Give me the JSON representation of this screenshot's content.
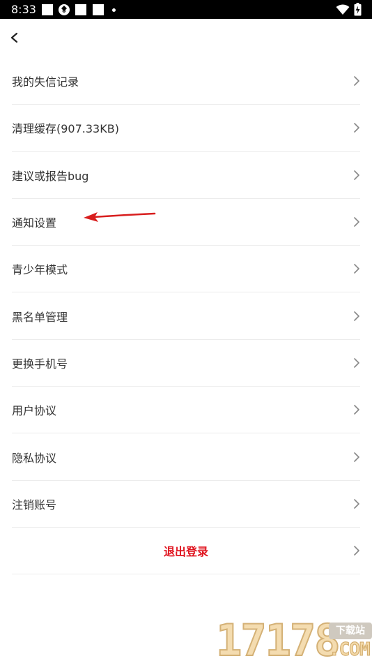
{
  "status_bar": {
    "time": "8:33"
  },
  "header": {
    "back_icon": "chevron-left-icon"
  },
  "settings": {
    "items": [
      {
        "label": "我的失信记录",
        "icon": "chevron-right-icon"
      },
      {
        "label": "清理缓存(907.33KB)",
        "icon": "chevron-right-icon"
      },
      {
        "label": "建议或报告bug",
        "icon": "chevron-right-icon"
      },
      {
        "label": "通知设置",
        "icon": "chevron-right-icon"
      },
      {
        "label": "青少年模式",
        "icon": "chevron-right-icon"
      },
      {
        "label": "黑名单管理",
        "icon": "chevron-right-icon"
      },
      {
        "label": "更换手机号",
        "icon": "chevron-right-icon"
      },
      {
        "label": "用户协议",
        "icon": "chevron-right-icon"
      },
      {
        "label": "隐私协议",
        "icon": "chevron-right-icon"
      },
      {
        "label": "注销账号",
        "icon": "chevron-right-icon"
      }
    ],
    "logout_label": "退出登录"
  },
  "watermark": {
    "digits": "17178",
    "tag": "下载站",
    "domain": ".COM"
  },
  "colors": {
    "logout_text": "#e0141f",
    "annotation_arrow": "#d81e1e",
    "divider": "#ececec",
    "label_text": "#333333"
  }
}
